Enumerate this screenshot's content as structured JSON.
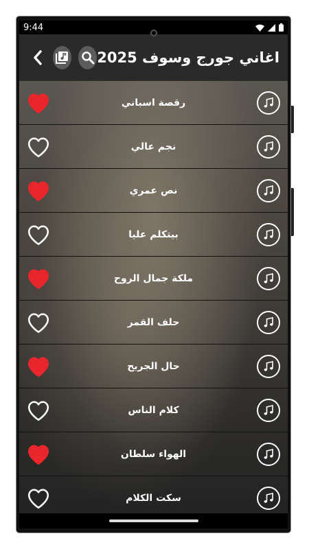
{
  "status": {
    "time": "9:44"
  },
  "appbar": {
    "title": "اغاني جورج وسوف 2025"
  },
  "songs": [
    {
      "title": "رقصة اسباني",
      "favorite": true
    },
    {
      "title": "نجم عالي",
      "favorite": false
    },
    {
      "title": "نص عمري",
      "favorite": true
    },
    {
      "title": "بيتكلم عليا",
      "favorite": false
    },
    {
      "title": "ملكة جمال الروح",
      "favorite": true
    },
    {
      "title": "حلف القمر",
      "favorite": false
    },
    {
      "title": "حال الجريح",
      "favorite": true
    },
    {
      "title": "كلام الناس",
      "favorite": false
    },
    {
      "title": "الهواء سلطان",
      "favorite": true
    },
    {
      "title": "سكت الكلام",
      "favorite": false
    }
  ],
  "icons": {
    "back": "chevron-left-icon",
    "playlist": "music-library-icon",
    "search": "search-icon",
    "favorite_on": "heart-filled-icon",
    "favorite_off": "heart-outline-icon",
    "song": "music-note-icon"
  },
  "colors": {
    "heart": "#e8262b",
    "appbar": "#2a2a2a",
    "circle_button": "#5c5c5c"
  }
}
